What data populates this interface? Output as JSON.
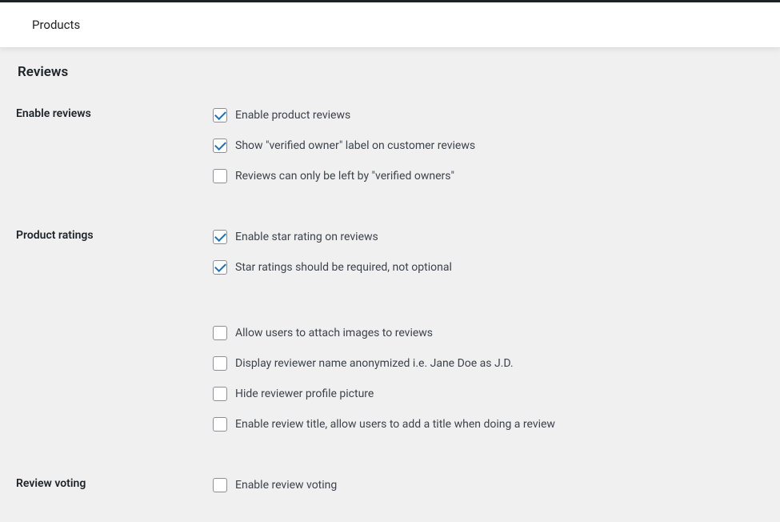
{
  "header": {
    "title": "Products"
  },
  "section": {
    "title": "Reviews"
  },
  "settings": {
    "enable_reviews": {
      "label": "Enable reviews",
      "options": [
        {
          "label": "Enable product reviews",
          "checked": true
        },
        {
          "label": "Show \"verified owner\" label on customer reviews",
          "checked": true
        },
        {
          "label": "Reviews can only be left by \"verified owners\"",
          "checked": false
        }
      ]
    },
    "product_ratings": {
      "label": "Product ratings",
      "options": [
        {
          "label": "Enable star rating on reviews",
          "checked": true
        },
        {
          "label": "Star ratings should be required, not optional",
          "checked": true
        }
      ],
      "extra_options": [
        {
          "label": "Allow users to attach images to reviews",
          "checked": false
        },
        {
          "label": "Display reviewer name anonymized i.e. Jane Doe as J.D.",
          "checked": false
        },
        {
          "label": "Hide reviewer profile picture",
          "checked": false
        },
        {
          "label": "Enable review title, allow users to add a title when doing a review",
          "checked": false
        }
      ]
    },
    "review_voting": {
      "label": "Review voting",
      "options": [
        {
          "label": "Enable review voting",
          "checked": false
        }
      ]
    }
  }
}
